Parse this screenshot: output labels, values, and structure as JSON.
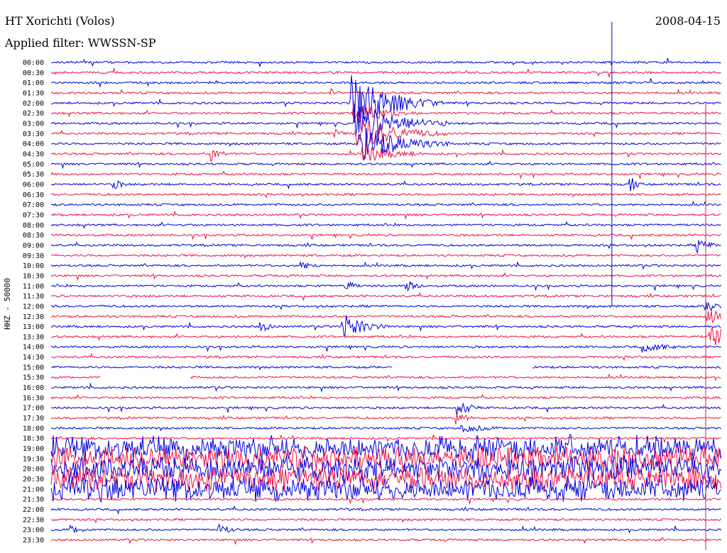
{
  "header": {
    "station": "HT Xorichti (Volos)",
    "date": "2008-04-15",
    "filter": "Applied filter: WWSSN-SP",
    "channel": "HHZ - 50000"
  },
  "colors": {
    "even_trace": "#0000dd",
    "odd_trace": "#ee1144",
    "background": "#ffffff"
  },
  "chart_data": {
    "type": "line",
    "title": "HT Xorichti (Volos)",
    "ylabel": "HHZ - 50000",
    "y_tick_labels": [
      "00:00",
      "00:30",
      "01:00",
      "01:30",
      "02:00",
      "02:30",
      "03:00",
      "03:30",
      "04:00",
      "04:30",
      "05:00",
      "05:30",
      "06:00",
      "06:30",
      "07:00",
      "07:30",
      "08:00",
      "08:30",
      "09:00",
      "09:30",
      "10:00",
      "10:30",
      "11:00",
      "11:30",
      "12:00",
      "12:30",
      "13:00",
      "13:30",
      "14:00",
      "14:30",
      "15:00",
      "15:30",
      "16:00",
      "16:30",
      "17:00",
      "17:30",
      "18:00",
      "18:30",
      "19:00",
      "19:30",
      "20:00",
      "20:30",
      "21:00",
      "21:30",
      "22:00",
      "22:30",
      "23:00",
      "23:30"
    ],
    "trace_minutes": 30,
    "events": [
      {
        "row": 3,
        "minute": 12.6,
        "amplitude": 5,
        "duration": 0.5
      },
      {
        "row": 7,
        "minute": 12.8,
        "amplitude": 6,
        "duration": 0.5
      },
      {
        "row": 4,
        "minute": 13.5,
        "amplitude": 38,
        "duration": 4
      },
      {
        "row": 5,
        "minute": 13.6,
        "amplitude": 16,
        "duration": 3
      },
      {
        "row": 6,
        "minute": 13.7,
        "amplitude": 30,
        "duration": 4
      },
      {
        "row": 7,
        "minute": 13.8,
        "amplitude": 22,
        "duration": 4
      },
      {
        "row": 8,
        "minute": 13.9,
        "amplitude": 26,
        "duration": 4
      },
      {
        "row": 9,
        "minute": 14.0,
        "amplitude": 14,
        "duration": 3
      },
      {
        "row": 12,
        "minute": 26.0,
        "amplitude": 10,
        "duration": 0.5
      },
      {
        "row": 9,
        "minute": 7.3,
        "amplitude": 8,
        "duration": 1
      },
      {
        "row": 12,
        "minute": 2.9,
        "amplitude": 6,
        "duration": 1
      },
      {
        "row": 18,
        "minute": 29.0,
        "amplitude": 10,
        "duration": 1
      },
      {
        "row": 20,
        "minute": 11.3,
        "amplitude": 6,
        "duration": 1
      },
      {
        "row": 22,
        "minute": 16.0,
        "amplitude": 8,
        "duration": 1
      },
      {
        "row": 22,
        "minute": 13.3,
        "amplitude": 6,
        "duration": 1
      },
      {
        "row": 26,
        "minute": 13.1,
        "amplitude": 18,
        "duration": 2
      },
      {
        "row": 28,
        "minute": 26.6,
        "amplitude": 8,
        "duration": 2
      },
      {
        "row": 26,
        "minute": 9.4,
        "amplitude": 8,
        "duration": 1
      },
      {
        "row": 27,
        "minute": 29.6,
        "amplitude": 14,
        "duration": 4
      },
      {
        "row": 25,
        "minute": 29.5,
        "amplitude": 10,
        "duration": 2
      },
      {
        "row": 24,
        "minute": 29.4,
        "amplitude": 8,
        "duration": 2
      },
      {
        "row": 34,
        "minute": 18.3,
        "amplitude": 12,
        "duration": 1
      },
      {
        "row": 35,
        "minute": 18.2,
        "amplitude": 8,
        "duration": 1
      },
      {
        "row": 36,
        "minute": 18.5,
        "amplitude": 6,
        "duration": 3
      },
      {
        "row": 46,
        "minute": 1.0,
        "amplitude": 6,
        "duration": 1
      },
      {
        "row": 46,
        "minute": 7.6,
        "amplitude": 8,
        "duration": 1
      }
    ],
    "noisy_rows": [
      38,
      39,
      40,
      41,
      42
    ],
    "gaps": [
      {
        "row": 30,
        "from_minute": 15.3,
        "to_minute": 21.5
      },
      {
        "row": 31,
        "from_minute": 2.2,
        "to_minute": 6.2
      }
    ],
    "markers": [
      {
        "x_minute": 25.1,
        "from_row": -4,
        "to_row": 24
      },
      {
        "x_minute": 29.3,
        "from_row": 4,
        "to_row": 48
      }
    ]
  }
}
